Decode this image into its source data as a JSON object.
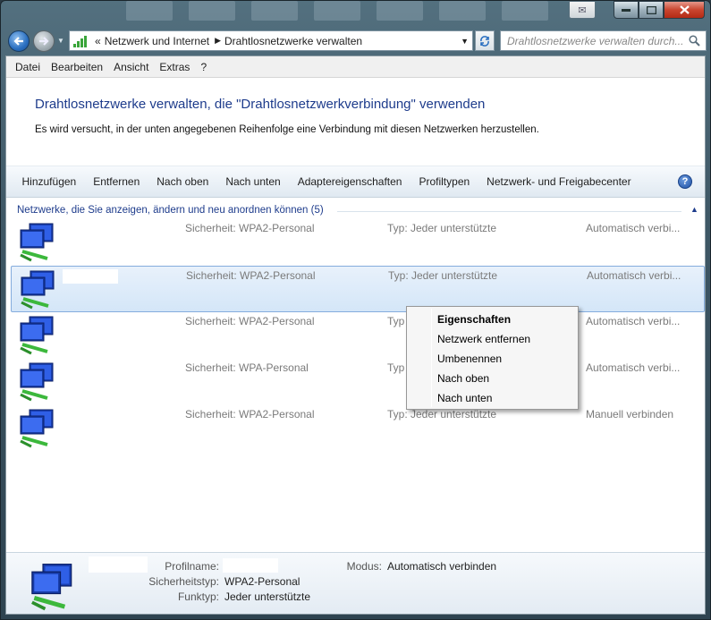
{
  "window": {
    "taskbar_button_symbol": "✉"
  },
  "nav": {
    "breadcrumb_prefix": "«",
    "breadcrumbs": [
      "Netzwerk und Internet",
      "Drahtlosnetzwerke verwalten"
    ],
    "search_placeholder": "Drahtlosnetzwerke verwalten durch..."
  },
  "menu": [
    "Datei",
    "Bearbeiten",
    "Ansicht",
    "Extras",
    "?"
  ],
  "header": {
    "title": "Drahtlosnetzwerke verwalten, die \"Drahtlosnetzwerkverbindung\" verwenden",
    "subtitle": "Es wird versucht, in der unten angegebenen Reihenfolge eine Verbindung mit diesen Netzwerken herzustellen."
  },
  "toolbar": [
    "Hinzufügen",
    "Entfernen",
    "Nach oben",
    "Nach unten",
    "Adaptereigenschaften",
    "Profiltypen",
    "Netzwerk- und Freigabecenter"
  ],
  "group": {
    "header": "Netzwerke, die Sie anzeigen, ändern und neu anordnen können (5)"
  },
  "networks": [
    {
      "security": "Sicherheit:  WPA2-Personal",
      "type": "Typ:  Jeder unterstützte",
      "mode": "Automatisch verbi..."
    },
    {
      "security": "Sicherheit:  WPA2-Personal",
      "type": "Typ:  Jeder unterstützte",
      "mode": "Automatisch verbi..."
    },
    {
      "security": "Sicherheit:  WPA2-Personal",
      "type": "Typ",
      "mode": "Automatisch verbi..."
    },
    {
      "security": "Sicherheit:  WPA-Personal",
      "type": "Typ",
      "mode": "Automatisch verbi..."
    },
    {
      "security": "Sicherheit:  WPA2-Personal",
      "type": "Typ:  Jeder unterstützte",
      "mode": "Manuell verbinden"
    }
  ],
  "context_menu": [
    "Eigenschaften",
    "Netzwerk entfernen",
    "Umbenennen",
    "Nach oben",
    "Nach unten"
  ],
  "details": {
    "profile_label": "Profilname:",
    "security_label": "Sicherheitstyp:",
    "security_value": "WPA2-Personal",
    "type_label": "Funktyp:",
    "type_value": "Jeder unterstützte",
    "mode_label": "Modus:",
    "mode_value": "Automatisch verbinden"
  },
  "colors": {
    "title_blue": "#1e3c8c",
    "selection_border": "#84acdd"
  }
}
